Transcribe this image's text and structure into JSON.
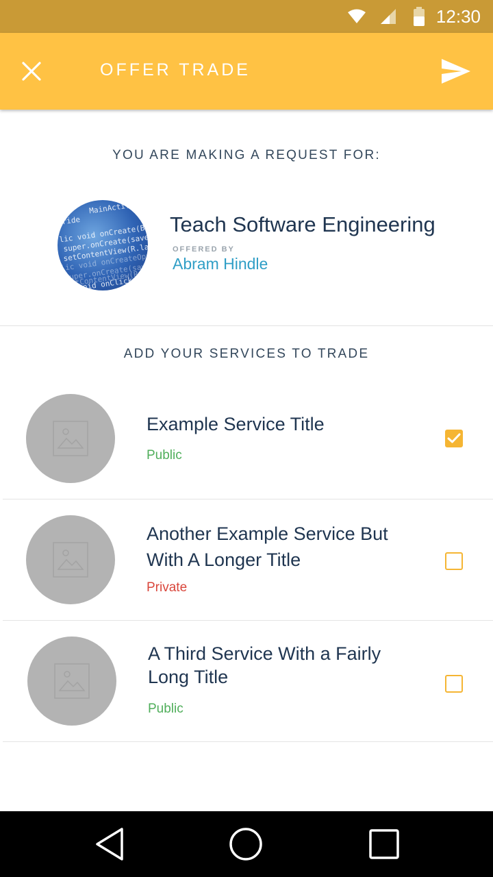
{
  "status_bar": {
    "time": "12:30",
    "icons": [
      "wifi-icon",
      "cell-signal-icon",
      "battery-icon"
    ],
    "color": "#c99a36"
  },
  "app_bar": {
    "title": "OFFER TRADE",
    "close_icon": "close-icon",
    "send_icon": "send-icon",
    "color": "#ffc244"
  },
  "request": {
    "heading": "YOU ARE MAKING A REQUEST FOR:",
    "service_title": "Teach Software Engineering",
    "offered_by_label": "OFFERED BY",
    "offered_by_name": "Abram Hindle",
    "image_lines": [
      "MainActivity",
      "rride",
      "lic void onCreate(Bun",
      "super.onCreate(saved",
      "setContentView(R.lay",
      "lic void onCreateOpt",
      "super.onCreate(savedInst",
      "setContentView(R.layou",
      "void onClick"
    ]
  },
  "services": {
    "heading": "ADD YOUR SERVICES TO TRADE",
    "items": [
      {
        "title": "Example Service Title",
        "visibility": "Public",
        "checked": true
      },
      {
        "title": "Another Example Service But With A Longer Title",
        "visibility": "Private",
        "checked": false
      },
      {
        "title": "A Third Service With a Fairly Long Title",
        "visibility": "Public",
        "checked": false
      }
    ]
  },
  "nav_bar": {
    "icons": [
      "back-icon",
      "home-icon",
      "recents-icon"
    ]
  },
  "colors": {
    "accent": "#f5b533",
    "public": "#4fae5a",
    "private": "#d9463b",
    "link": "#2f9ec6"
  }
}
